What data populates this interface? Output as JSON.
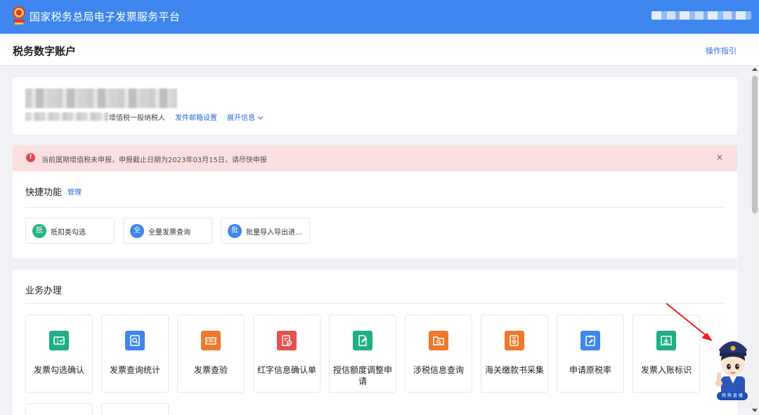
{
  "header": {
    "platform_title": "国家税务总局电子发票服务平台"
  },
  "subheader": {
    "page_title": "税务数字账户",
    "guide_link": "操作指引"
  },
  "company": {
    "taxpayer_type": "增值税一般纳税人",
    "email_settings": "发件邮箱设置",
    "expand_info": "展开信息"
  },
  "alert": {
    "icon": "!",
    "message": "当前属期增值税未申报，申报截止日期为2023年03月15日，请尽快申报",
    "close": "×"
  },
  "quick": {
    "title": "快捷功能",
    "manage": "管理",
    "items": [
      {
        "badge": "抵",
        "label": "抵扣类勾选",
        "color": "#27b383"
      },
      {
        "badge": "全",
        "label": "全量发票查询",
        "color": "#3f86ee"
      },
      {
        "badge": "批",
        "label": "批量导入导出进...",
        "color": "#3f86ee"
      }
    ]
  },
  "business": {
    "title": "业务办理",
    "tiles": [
      {
        "label": "发票勾选确认",
        "icon": "ticket-check-icon",
        "color": "#1fae85"
      },
      {
        "label": "发票查询统计",
        "icon": "search-document-icon",
        "color": "#3f86ee"
      },
      {
        "label": "发票查验",
        "icon": "ticket-icon",
        "color": "#f0782c"
      },
      {
        "label": "红字信息确认单",
        "icon": "red-document-icon",
        "color": "#e8504e"
      },
      {
        "label": "授信额度调整申请",
        "icon": "edit-document-icon",
        "color": "#1fae85"
      },
      {
        "label": "涉税信息查询",
        "icon": "folder-search-icon",
        "color": "#f0782c"
      },
      {
        "label": "海关缴款书采集",
        "icon": "customs-document-icon",
        "color": "#f0782c"
      },
      {
        "label": "申请原税率",
        "icon": "clipboard-edit-icon",
        "color": "#3f86ee"
      },
      {
        "label": "发票入账标识",
        "icon": "tray-download-icon",
        "color": "#1fae85"
      }
    ]
  },
  "mascot": {
    "label": "税 购 直 播"
  }
}
